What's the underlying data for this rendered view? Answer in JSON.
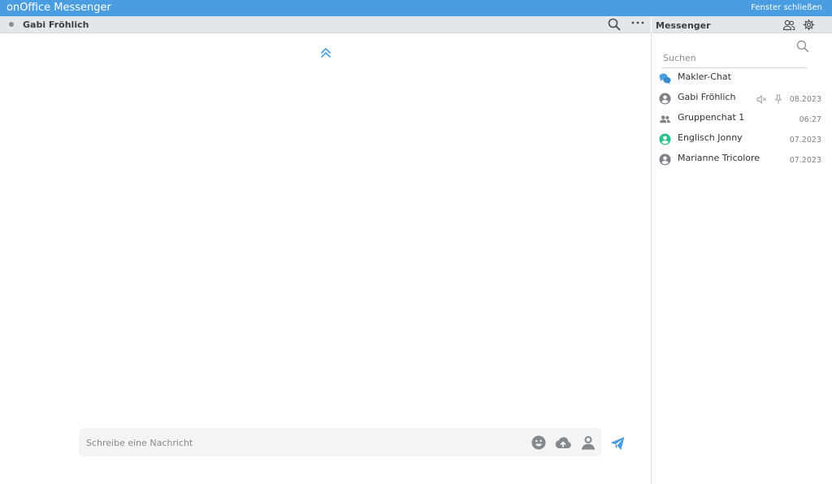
{
  "window": {
    "title": "onOffice Messenger",
    "close_label": "Fenster schließen"
  },
  "chat": {
    "name": "Gabi Fröhlich",
    "composer_placeholder": "Schreibe eine Nachricht"
  },
  "sidebar": {
    "title": "Messenger",
    "search_placeholder": "Suchen",
    "items": [
      {
        "name": "Makler-Chat",
        "time": "",
        "icon": "chat-bubbles-icon"
      },
      {
        "name": "Gabi Fröhlich",
        "time": "08.2023",
        "icon": "user-icon",
        "muted": true,
        "pinned": true
      },
      {
        "name": "Gruppenchat 1",
        "time": "06:27",
        "icon": "group-icon"
      },
      {
        "name": "Englisch Jonny",
        "time": "07.2023",
        "icon": "user-online-icon"
      },
      {
        "name": "Marianne Tricolore",
        "time": "07.2023",
        "icon": "user-icon"
      }
    ]
  },
  "colors": {
    "titlebar": "#4a9de0",
    "accent": "#4a9de0",
    "online": "#2fbf8a",
    "icon_gray": "#7f8388"
  }
}
